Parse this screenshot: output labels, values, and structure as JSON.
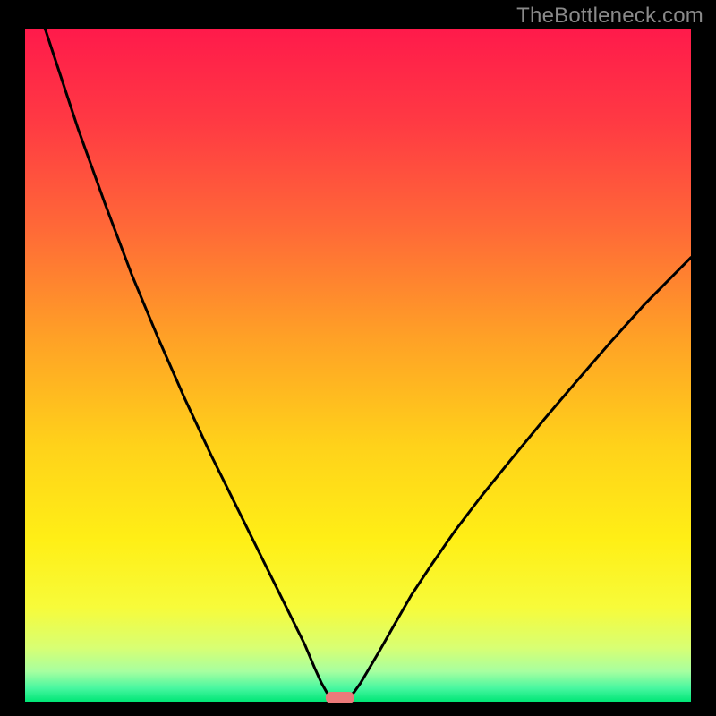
{
  "watermark": "TheBottleneck.com",
  "frame": {
    "outer_w": 800,
    "outer_h": 800,
    "border_left": 28,
    "border_right": 28,
    "border_top": 32,
    "border_bottom": 16
  },
  "gradient_stops": [
    {
      "offset": 0.0,
      "color": "#ff1a4b"
    },
    {
      "offset": 0.14,
      "color": "#ff3a43"
    },
    {
      "offset": 0.3,
      "color": "#ff6a37"
    },
    {
      "offset": 0.46,
      "color": "#ffa126"
    },
    {
      "offset": 0.62,
      "color": "#ffd21a"
    },
    {
      "offset": 0.76,
      "color": "#ffef16"
    },
    {
      "offset": 0.86,
      "color": "#f7fb3a"
    },
    {
      "offset": 0.92,
      "color": "#d8ff73"
    },
    {
      "offset": 0.955,
      "color": "#a7ffa0"
    },
    {
      "offset": 0.98,
      "color": "#48f7a0"
    },
    {
      "offset": 1.0,
      "color": "#00e676"
    }
  ],
  "curve": {
    "color": "#000000",
    "width": 3
  },
  "marker": {
    "fill": "#eb7a7a",
    "stroke": "none",
    "w": 32,
    "h": 13,
    "rx": 6
  },
  "chart_data": {
    "type": "line",
    "title": "",
    "xlabel": "",
    "ylabel": "",
    "note": "Bottleneck-style V curve; values are approximate percentages read from pixel positions.",
    "x_range": [
      0,
      100
    ],
    "y_range": [
      0,
      100
    ],
    "curve_points": [
      {
        "x": 3.0,
        "y": 100.0
      },
      {
        "x": 5.0,
        "y": 94.0
      },
      {
        "x": 8.0,
        "y": 85.0
      },
      {
        "x": 12.0,
        "y": 74.0
      },
      {
        "x": 16.0,
        "y": 63.5
      },
      {
        "x": 20.0,
        "y": 54.0
      },
      {
        "x": 24.0,
        "y": 45.0
      },
      {
        "x": 28.0,
        "y": 36.5
      },
      {
        "x": 32.0,
        "y": 28.5
      },
      {
        "x": 35.0,
        "y": 22.5
      },
      {
        "x": 38.0,
        "y": 16.5
      },
      {
        "x": 40.0,
        "y": 12.5
      },
      {
        "x": 42.0,
        "y": 8.5
      },
      {
        "x": 43.5,
        "y": 5.0
      },
      {
        "x": 44.5,
        "y": 2.8
      },
      {
        "x": 45.3,
        "y": 1.4
      },
      {
        "x": 46.0,
        "y": 0.6
      },
      {
        "x": 46.7,
        "y": 0.2
      },
      {
        "x": 47.3,
        "y": 0.05
      },
      {
        "x": 47.9,
        "y": 0.2
      },
      {
        "x": 48.6,
        "y": 0.6
      },
      {
        "x": 49.4,
        "y": 1.4
      },
      {
        "x": 50.4,
        "y": 2.8
      },
      {
        "x": 51.6,
        "y": 4.8
      },
      {
        "x": 53.2,
        "y": 7.5
      },
      {
        "x": 55.5,
        "y": 11.5
      },
      {
        "x": 58.0,
        "y": 15.8
      },
      {
        "x": 61.0,
        "y": 20.3
      },
      {
        "x": 64.5,
        "y": 25.3
      },
      {
        "x": 68.5,
        "y": 30.5
      },
      {
        "x": 73.0,
        "y": 36.0
      },
      {
        "x": 78.0,
        "y": 42.0
      },
      {
        "x": 83.0,
        "y": 47.8
      },
      {
        "x": 88.0,
        "y": 53.5
      },
      {
        "x": 93.0,
        "y": 59.0
      },
      {
        "x": 97.0,
        "y": 63.0
      },
      {
        "x": 100.0,
        "y": 66.0
      }
    ],
    "optimal_marker": {
      "x": 47.3,
      "y": 0.0
    }
  }
}
